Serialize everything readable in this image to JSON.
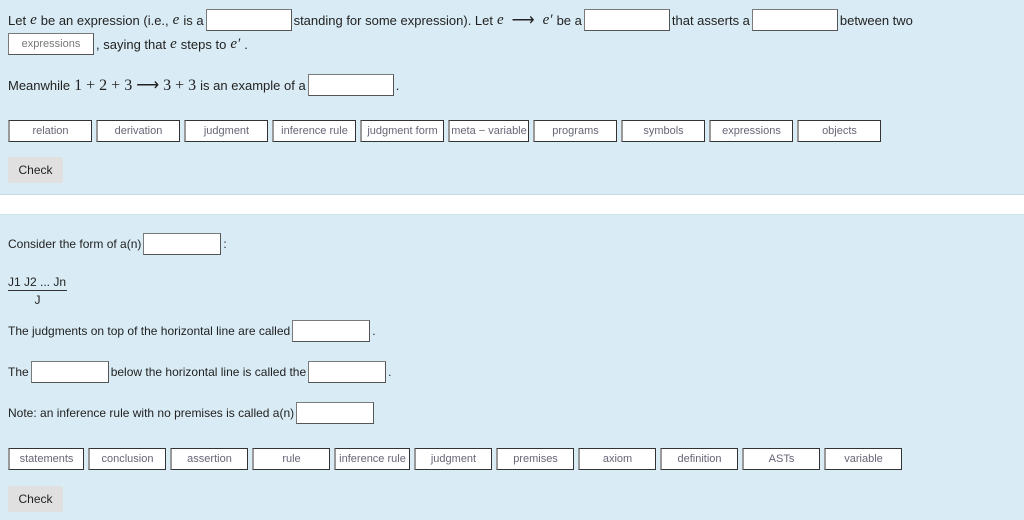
{
  "section1": {
    "sentence1": {
      "t1": "Let ",
      "e": "e",
      "t2": " be an expression (i.e., ",
      "t3": " is a",
      "t4": "standing for some expression). Let ",
      "arrow": "⟶",
      "eprime": "e′",
      "t5": " be a",
      "t6": "that asserts a",
      "t7": "between two",
      "filled_blank": "expressions",
      "t8": ", saying that ",
      "t9": " steps to ",
      "t10": "."
    },
    "sentence2": {
      "t1": "Meanwhile ",
      "math": "1 + 2 + 3 ⟶ 3 + 3",
      "t2": " is an example of a",
      "t3": "."
    },
    "options": [
      "relation",
      "derivation",
      "judgment",
      "inference rule",
      "judgment form",
      "meta − variable",
      "programs",
      "symbols",
      "expressions",
      "objects"
    ],
    "check_label": "Check"
  },
  "section2": {
    "q1": {
      "t1": "Consider the form of a(n)",
      "t2": ":"
    },
    "rule": {
      "premises": "J1 J2 ... Jn",
      "conclusion": "J"
    },
    "q2": {
      "t1": "The judgments on top of the horizontal line are called",
      "t2": "."
    },
    "q3": {
      "t1": "The",
      "t2": "below the horizontal line is called the",
      "t3": "."
    },
    "q4": {
      "t1": "Note: an inference rule with no premises is called a(n)"
    },
    "options": [
      "statements",
      "conclusion",
      "assertion",
      "rule",
      "inference rule",
      "judgment",
      "premises",
      "axiom",
      "definition",
      "ASTs",
      "variable"
    ],
    "check_label": "Check"
  }
}
